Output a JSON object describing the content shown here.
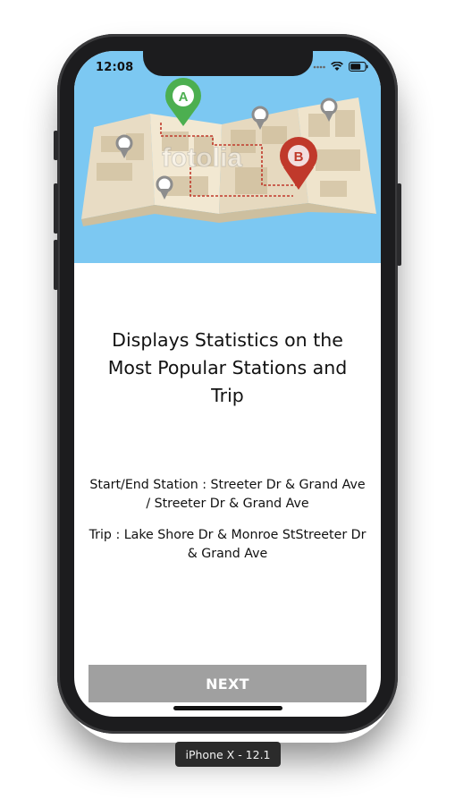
{
  "status_bar": {
    "time": "12:08"
  },
  "hero": {
    "watermark": "fotolia",
    "pin_a_label": "A",
    "pin_b_label": "B"
  },
  "content": {
    "title": "Displays Statistics on the Most Popular Stations and Trip",
    "station_text": "Start/End Station : Streeter Dr & Grand Ave / Streeter Dr & Grand Ave",
    "trip_text": "Trip : Lake Shore Dr & Monroe StStreeter Dr & Grand Ave"
  },
  "footer": {
    "next_label": "NEXT"
  },
  "device": {
    "label": "iPhone X - 12.1"
  },
  "colors": {
    "sky": "#7cc8f2",
    "pin_a": "#4caf50",
    "pin_b": "#c0392b",
    "button": "#a0a0a0"
  },
  "icons": [
    "wifi-icon",
    "battery-icon",
    "signal-icon",
    "map-pin-icon"
  ]
}
